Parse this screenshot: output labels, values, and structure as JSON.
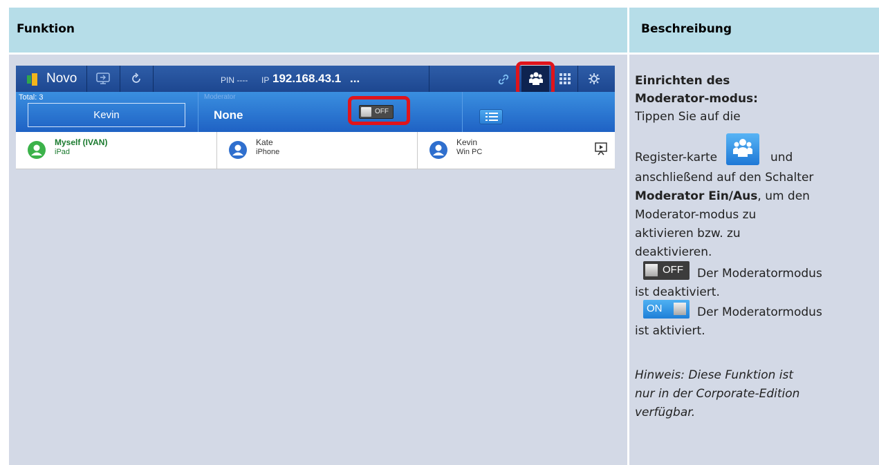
{
  "header": {
    "col_function": "Funktion",
    "col_description": "Beschreibung"
  },
  "app": {
    "brand": "Novo",
    "pin_label": "PIN ----",
    "ip_prefix": "IP",
    "ip_value": "192.168.43.1",
    "ip_more": "...",
    "total_label": "Total: 3",
    "presenter_name": "Kevin",
    "moderator_label": "Moderator",
    "moderator_value": "None",
    "toggle_label": "OFF",
    "participants": [
      {
        "name": "Myself (IVAN)",
        "device": "iPad",
        "color": "#3bb24a"
      },
      {
        "name": "Kate",
        "device": "iPhone",
        "color": "#2f6fce"
      },
      {
        "name": "Kevin",
        "device": "Win PC",
        "color": "#2f6fce"
      }
    ]
  },
  "description": {
    "title_line1": "Einrichten des",
    "title_line2": "Moderator-modus:",
    "line1": "Tippen Sie auf die",
    "register_text": "Register-karte",
    "und": "und",
    "line3": "anschließend auf den Schalter",
    "bold_switch": "Moderator Ein/Aus",
    "line4_rest": ", um den",
    "line5": "Moderator-modus zu",
    "line6": "aktivieren bzw. zu",
    "line7": "deaktivieren.",
    "off_label": "OFF",
    "off_text": "Der Moderatormodus",
    "off_text2": "ist deaktiviert.",
    "on_label": "ON",
    "on_text": "Der Moderatormodus",
    "on_text2": "ist aktiviert.",
    "note1": "Hinweis: Diese Funktion ist",
    "note2": "nur in der Corporate-Edition",
    "note3": "verfügbar."
  }
}
